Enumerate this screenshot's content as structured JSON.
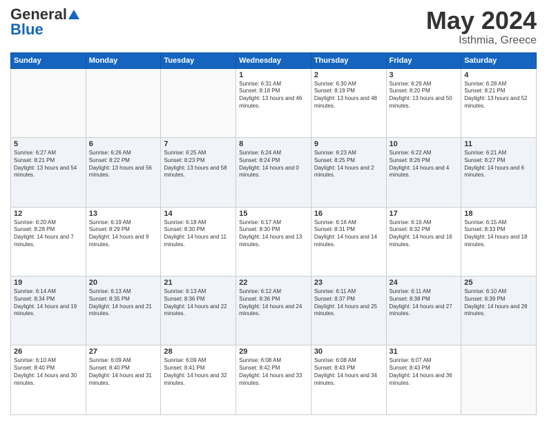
{
  "header": {
    "logo_general": "General",
    "logo_blue": "Blue",
    "title": "May 2024",
    "location": "Isthmia, Greece"
  },
  "days_of_week": [
    "Sunday",
    "Monday",
    "Tuesday",
    "Wednesday",
    "Thursday",
    "Friday",
    "Saturday"
  ],
  "weeks": [
    [
      {
        "day": "",
        "empty": true
      },
      {
        "day": "",
        "empty": true
      },
      {
        "day": "",
        "empty": true
      },
      {
        "day": "1",
        "sunrise": "6:31 AM",
        "sunset": "8:18 PM",
        "daylight": "13 hours and 46 minutes."
      },
      {
        "day": "2",
        "sunrise": "6:30 AM",
        "sunset": "8:19 PM",
        "daylight": "13 hours and 48 minutes."
      },
      {
        "day": "3",
        "sunrise": "6:29 AM",
        "sunset": "8:20 PM",
        "daylight": "13 hours and 50 minutes."
      },
      {
        "day": "4",
        "sunrise": "6:28 AM",
        "sunset": "8:21 PM",
        "daylight": "13 hours and 52 minutes."
      }
    ],
    [
      {
        "day": "5",
        "sunrise": "6:27 AM",
        "sunset": "8:21 PM",
        "daylight": "13 hours and 54 minutes."
      },
      {
        "day": "6",
        "sunrise": "6:26 AM",
        "sunset": "8:22 PM",
        "daylight": "13 hours and 56 minutes."
      },
      {
        "day": "7",
        "sunrise": "6:25 AM",
        "sunset": "8:23 PM",
        "daylight": "13 hours and 58 minutes."
      },
      {
        "day": "8",
        "sunrise": "6:24 AM",
        "sunset": "8:24 PM",
        "daylight": "14 hours and 0 minutes."
      },
      {
        "day": "9",
        "sunrise": "6:23 AM",
        "sunset": "8:25 PM",
        "daylight": "14 hours and 2 minutes."
      },
      {
        "day": "10",
        "sunrise": "6:22 AM",
        "sunset": "8:26 PM",
        "daylight": "14 hours and 4 minutes."
      },
      {
        "day": "11",
        "sunrise": "6:21 AM",
        "sunset": "8:27 PM",
        "daylight": "14 hours and 6 minutes."
      }
    ],
    [
      {
        "day": "12",
        "sunrise": "6:20 AM",
        "sunset": "8:28 PM",
        "daylight": "14 hours and 7 minutes."
      },
      {
        "day": "13",
        "sunrise": "6:19 AM",
        "sunset": "8:29 PM",
        "daylight": "14 hours and 9 minutes."
      },
      {
        "day": "14",
        "sunrise": "6:18 AM",
        "sunset": "8:30 PM",
        "daylight": "14 hours and 11 minutes."
      },
      {
        "day": "15",
        "sunrise": "6:17 AM",
        "sunset": "8:30 PM",
        "daylight": "14 hours and 13 minutes."
      },
      {
        "day": "16",
        "sunrise": "6:16 AM",
        "sunset": "8:31 PM",
        "daylight": "14 hours and 14 minutes."
      },
      {
        "day": "17",
        "sunrise": "6:16 AM",
        "sunset": "8:32 PM",
        "daylight": "14 hours and 16 minutes."
      },
      {
        "day": "18",
        "sunrise": "6:15 AM",
        "sunset": "8:33 PM",
        "daylight": "14 hours and 18 minutes."
      }
    ],
    [
      {
        "day": "19",
        "sunrise": "6:14 AM",
        "sunset": "8:34 PM",
        "daylight": "14 hours and 19 minutes."
      },
      {
        "day": "20",
        "sunrise": "6:13 AM",
        "sunset": "8:35 PM",
        "daylight": "14 hours and 21 minutes."
      },
      {
        "day": "21",
        "sunrise": "6:13 AM",
        "sunset": "8:36 PM",
        "daylight": "14 hours and 22 minutes."
      },
      {
        "day": "22",
        "sunrise": "6:12 AM",
        "sunset": "8:36 PM",
        "daylight": "14 hours and 24 minutes."
      },
      {
        "day": "23",
        "sunrise": "6:11 AM",
        "sunset": "8:37 PM",
        "daylight": "14 hours and 25 minutes."
      },
      {
        "day": "24",
        "sunrise": "6:11 AM",
        "sunset": "8:38 PM",
        "daylight": "14 hours and 27 minutes."
      },
      {
        "day": "25",
        "sunrise": "6:10 AM",
        "sunset": "8:39 PM",
        "daylight": "14 hours and 28 minutes."
      }
    ],
    [
      {
        "day": "26",
        "sunrise": "6:10 AM",
        "sunset": "8:40 PM",
        "daylight": "14 hours and 30 minutes."
      },
      {
        "day": "27",
        "sunrise": "6:09 AM",
        "sunset": "8:40 PM",
        "daylight": "14 hours and 31 minutes."
      },
      {
        "day": "28",
        "sunrise": "6:09 AM",
        "sunset": "8:41 PM",
        "daylight": "14 hours and 32 minutes."
      },
      {
        "day": "29",
        "sunrise": "6:08 AM",
        "sunset": "8:42 PM",
        "daylight": "14 hours and 33 minutes."
      },
      {
        "day": "30",
        "sunrise": "6:08 AM",
        "sunset": "8:43 PM",
        "daylight": "14 hours and 34 minutes."
      },
      {
        "day": "31",
        "sunrise": "6:07 AM",
        "sunset": "8:43 PM",
        "daylight": "14 hours and 36 minutes."
      },
      {
        "day": "",
        "empty": true
      }
    ]
  ]
}
